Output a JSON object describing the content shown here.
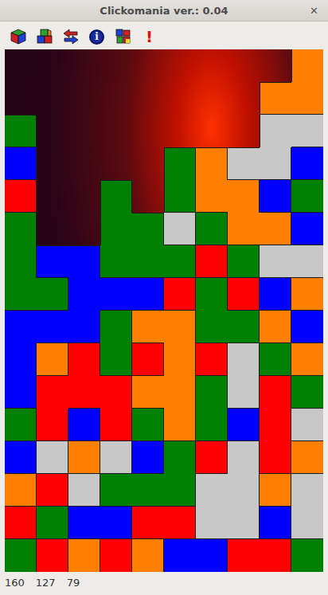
{
  "window": {
    "title": "Clickomania ver.: 0.04",
    "close": "✕"
  },
  "toolbar": [
    {
      "kind": "cube"
    },
    {
      "kind": "cubes"
    },
    {
      "kind": "undo"
    },
    {
      "kind": "info",
      "text": "i"
    },
    {
      "kind": "colors"
    },
    {
      "kind": "alert",
      "text": "!"
    }
  ],
  "board": {
    "rows": [
      [
        {
          "kind": "empty"
        },
        {
          "kind": "empty"
        },
        {
          "kind": "empty"
        },
        {
          "kind": "empty"
        },
        {
          "kind": "empty"
        },
        {
          "kind": "empty"
        },
        {
          "kind": "empty"
        },
        {
          "kind": "empty"
        },
        {
          "kind": "empty"
        },
        {
          "kind": "block",
          "color": "#ff8000"
        }
      ],
      [
        {
          "kind": "empty"
        },
        {
          "kind": "empty"
        },
        {
          "kind": "empty"
        },
        {
          "kind": "empty"
        },
        {
          "kind": "empty"
        },
        {
          "kind": "empty"
        },
        {
          "kind": "empty"
        },
        {
          "kind": "empty"
        },
        {
          "kind": "block",
          "color": "#ff8000"
        },
        {
          "kind": "block",
          "color": "#ff8000"
        }
      ],
      [
        {
          "kind": "block",
          "color": "#008000"
        },
        {
          "kind": "empty"
        },
        {
          "kind": "empty"
        },
        {
          "kind": "empty"
        },
        {
          "kind": "empty"
        },
        {
          "kind": "empty"
        },
        {
          "kind": "empty"
        },
        {
          "kind": "empty"
        },
        {
          "kind": "block",
          "color": "#c8c8c8"
        },
        {
          "kind": "block",
          "color": "#c8c8c8"
        }
      ],
      [
        {
          "kind": "block",
          "color": "#0000ff"
        },
        {
          "kind": "empty"
        },
        {
          "kind": "empty"
        },
        {
          "kind": "empty"
        },
        {
          "kind": "empty"
        },
        {
          "kind": "block",
          "color": "#008000"
        },
        {
          "kind": "block",
          "color": "#ff8000"
        },
        {
          "kind": "block",
          "color": "#c8c8c8"
        },
        {
          "kind": "block",
          "color": "#c8c8c8"
        },
        {
          "kind": "block",
          "color": "#0000ff"
        }
      ],
      [
        {
          "kind": "block",
          "color": "#ff0000"
        },
        {
          "kind": "empty"
        },
        {
          "kind": "empty"
        },
        {
          "kind": "block",
          "color": "#008000"
        },
        {
          "kind": "empty"
        },
        {
          "kind": "block",
          "color": "#008000"
        },
        {
          "kind": "block",
          "color": "#ff8000"
        },
        {
          "kind": "block",
          "color": "#ff8000"
        },
        {
          "kind": "block",
          "color": "#0000ff"
        },
        {
          "kind": "block",
          "color": "#008000"
        }
      ],
      [
        {
          "kind": "block",
          "color": "#008000"
        },
        {
          "kind": "empty"
        },
        {
          "kind": "empty"
        },
        {
          "kind": "block",
          "color": "#008000"
        },
        {
          "kind": "block",
          "color": "#008000"
        },
        {
          "kind": "block",
          "color": "#c8c8c8"
        },
        {
          "kind": "block",
          "color": "#008000"
        },
        {
          "kind": "block",
          "color": "#ff8000"
        },
        {
          "kind": "block",
          "color": "#ff8000"
        },
        {
          "kind": "block",
          "color": "#0000ff"
        }
      ],
      [
        {
          "kind": "block",
          "color": "#008000"
        },
        {
          "kind": "block",
          "color": "#0000ff"
        },
        {
          "kind": "block",
          "color": "#0000ff"
        },
        {
          "kind": "block",
          "color": "#008000"
        },
        {
          "kind": "block",
          "color": "#008000"
        },
        {
          "kind": "block",
          "color": "#008000"
        },
        {
          "kind": "block",
          "color": "#ff0000"
        },
        {
          "kind": "block",
          "color": "#008000"
        },
        {
          "kind": "block",
          "color": "#c8c8c8"
        },
        {
          "kind": "block",
          "color": "#c8c8c8"
        }
      ],
      [
        {
          "kind": "block",
          "color": "#008000"
        },
        {
          "kind": "block",
          "color": "#008000"
        },
        {
          "kind": "block",
          "color": "#0000ff"
        },
        {
          "kind": "block",
          "color": "#0000ff"
        },
        {
          "kind": "block",
          "color": "#0000ff"
        },
        {
          "kind": "block",
          "color": "#ff0000"
        },
        {
          "kind": "block",
          "color": "#008000"
        },
        {
          "kind": "block",
          "color": "#ff0000"
        },
        {
          "kind": "block",
          "color": "#0000ff"
        },
        {
          "kind": "block",
          "color": "#ff8000"
        }
      ],
      [
        {
          "kind": "block",
          "color": "#0000ff"
        },
        {
          "kind": "block",
          "color": "#0000ff"
        },
        {
          "kind": "block",
          "color": "#0000ff"
        },
        {
          "kind": "block",
          "color": "#008000"
        },
        {
          "kind": "block",
          "color": "#ff8000"
        },
        {
          "kind": "block",
          "color": "#ff8000"
        },
        {
          "kind": "block",
          "color": "#008000"
        },
        {
          "kind": "block",
          "color": "#008000"
        },
        {
          "kind": "block",
          "color": "#ff8000"
        },
        {
          "kind": "block",
          "color": "#0000ff"
        }
      ],
      [
        {
          "kind": "block",
          "color": "#0000ff"
        },
        {
          "kind": "block",
          "color": "#ff8000"
        },
        {
          "kind": "block",
          "color": "#ff0000"
        },
        {
          "kind": "block",
          "color": "#008000"
        },
        {
          "kind": "block",
          "color": "#ff0000"
        },
        {
          "kind": "block",
          "color": "#ff8000"
        },
        {
          "kind": "block",
          "color": "#ff0000"
        },
        {
          "kind": "block",
          "color": "#c8c8c8"
        },
        {
          "kind": "block",
          "color": "#008000"
        },
        {
          "kind": "block",
          "color": "#ff8000"
        }
      ],
      [
        {
          "kind": "block",
          "color": "#0000ff"
        },
        {
          "kind": "block",
          "color": "#ff0000"
        },
        {
          "kind": "block",
          "color": "#ff0000"
        },
        {
          "kind": "block",
          "color": "#ff0000"
        },
        {
          "kind": "block",
          "color": "#ff8000"
        },
        {
          "kind": "block",
          "color": "#ff8000"
        },
        {
          "kind": "block",
          "color": "#008000"
        },
        {
          "kind": "block",
          "color": "#c8c8c8"
        },
        {
          "kind": "block",
          "color": "#ff0000"
        },
        {
          "kind": "block",
          "color": "#008000"
        }
      ],
      [
        {
          "kind": "block",
          "color": "#008000"
        },
        {
          "kind": "block",
          "color": "#ff0000"
        },
        {
          "kind": "block",
          "color": "#0000ff"
        },
        {
          "kind": "block",
          "color": "#ff0000"
        },
        {
          "kind": "block",
          "color": "#008000"
        },
        {
          "kind": "block",
          "color": "#ff8000"
        },
        {
          "kind": "block",
          "color": "#008000"
        },
        {
          "kind": "block",
          "color": "#0000ff"
        },
        {
          "kind": "block",
          "color": "#ff0000"
        },
        {
          "kind": "block",
          "color": "#c8c8c8"
        }
      ],
      [
        {
          "kind": "block",
          "color": "#0000ff"
        },
        {
          "kind": "block",
          "color": "#c8c8c8"
        },
        {
          "kind": "block",
          "color": "#ff8000"
        },
        {
          "kind": "block",
          "color": "#c8c8c8"
        },
        {
          "kind": "block",
          "color": "#0000ff"
        },
        {
          "kind": "block",
          "color": "#008000"
        },
        {
          "kind": "block",
          "color": "#ff0000"
        },
        {
          "kind": "block",
          "color": "#c8c8c8"
        },
        {
          "kind": "block",
          "color": "#ff0000"
        },
        {
          "kind": "block",
          "color": "#ff8000"
        }
      ],
      [
        {
          "kind": "block",
          "color": "#ff8000"
        },
        {
          "kind": "block",
          "color": "#ff0000"
        },
        {
          "kind": "block",
          "color": "#c8c8c8"
        },
        {
          "kind": "block",
          "color": "#008000"
        },
        {
          "kind": "block",
          "color": "#008000"
        },
        {
          "kind": "block",
          "color": "#008000"
        },
        {
          "kind": "block",
          "color": "#c8c8c8"
        },
        {
          "kind": "block",
          "color": "#c8c8c8"
        },
        {
          "kind": "block",
          "color": "#ff8000"
        },
        {
          "kind": "block",
          "color": "#c8c8c8"
        }
      ],
      [
        {
          "kind": "block",
          "color": "#ff0000"
        },
        {
          "kind": "block",
          "color": "#008000"
        },
        {
          "kind": "block",
          "color": "#0000ff"
        },
        {
          "kind": "block",
          "color": "#0000ff"
        },
        {
          "kind": "block",
          "color": "#ff0000"
        },
        {
          "kind": "block",
          "color": "#ff0000"
        },
        {
          "kind": "block",
          "color": "#c8c8c8"
        },
        {
          "kind": "block",
          "color": "#c8c8c8"
        },
        {
          "kind": "block",
          "color": "#0000ff"
        },
        {
          "kind": "block",
          "color": "#c8c8c8"
        }
      ],
      [
        {
          "kind": "block",
          "color": "#008000"
        },
        {
          "kind": "block",
          "color": "#ff0000"
        },
        {
          "kind": "block",
          "color": "#ff8000"
        },
        {
          "kind": "block",
          "color": "#ff0000"
        },
        {
          "kind": "block",
          "color": "#ff8000"
        },
        {
          "kind": "block",
          "color": "#0000ff"
        },
        {
          "kind": "block",
          "color": "#0000ff"
        },
        {
          "kind": "block",
          "color": "#ff0000"
        },
        {
          "kind": "block",
          "color": "#ff0000"
        },
        {
          "kind": "block",
          "color": "#008000"
        }
      ]
    ]
  },
  "status_bar": [
    "160",
    "127",
    "79"
  ]
}
